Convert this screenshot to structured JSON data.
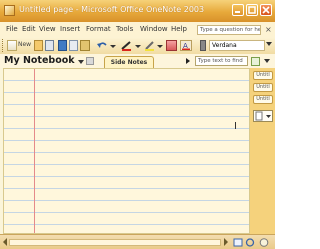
{
  "window": {
    "title": "Untitled page - Microsoft Office OneNote 2003"
  },
  "menu": {
    "items": [
      "File",
      "Edit",
      "View",
      "Insert",
      "Format",
      "Tools",
      "Window",
      "Help"
    ],
    "help_placeholder": "Type a question for help"
  },
  "toolbar": {
    "new_label": "New",
    "font_name": "Verdana"
  },
  "notebook": {
    "title": "My Notebook",
    "section_tab": "Side Notes",
    "find_placeholder": "Type text to find"
  },
  "pages": {
    "tabs": [
      "Untitl",
      "Untitl",
      "Untitl"
    ]
  },
  "icons": {
    "window": [
      "onenote-app-icon",
      "minimize-icon",
      "maximize-icon",
      "close-icon"
    ],
    "toolbar": [
      "new-page-icon",
      "open-icon",
      "print-icon",
      "cut-icon",
      "copy-icon",
      "paste-icon",
      "undo-icon",
      "pen-icon",
      "highlighter-icon",
      "eraser-icon",
      "font-color-icon"
    ],
    "find": [
      "find-go-icon"
    ]
  },
  "colors": {
    "title_bar": "#e7a93b",
    "page_background": "#fff7dc",
    "rule_lines": "#c5d6e4",
    "margin_line": "#e58a8a",
    "tab_strip": "#f5d27c"
  }
}
